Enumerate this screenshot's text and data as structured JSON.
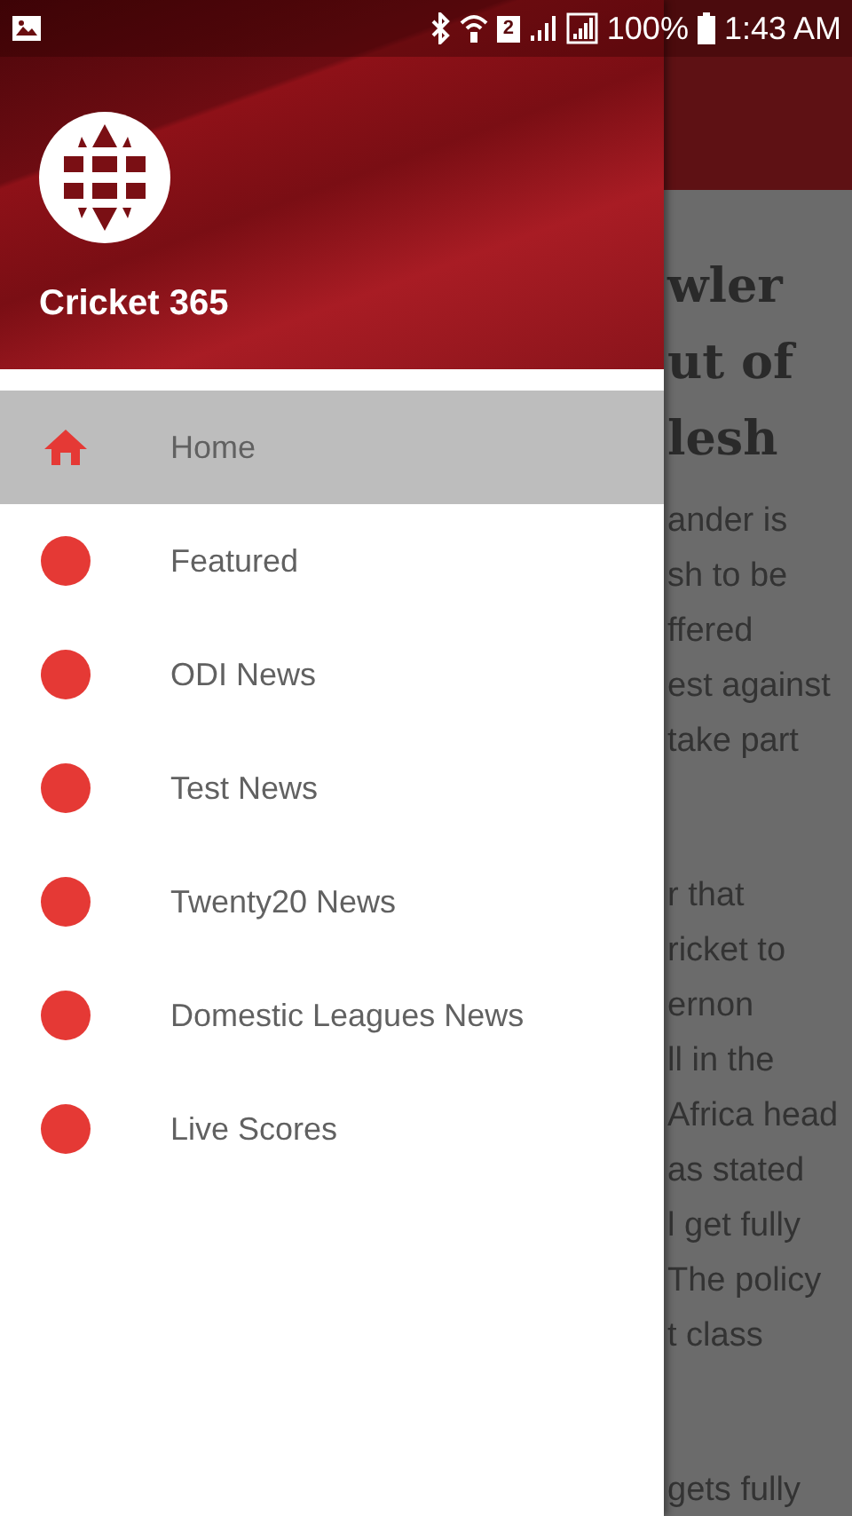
{
  "status_bar": {
    "sim": "2",
    "battery": "100%",
    "time": "1:43 AM"
  },
  "drawer": {
    "title": "Cricket 365",
    "items": [
      {
        "kind": "home",
        "label": "Home",
        "selected": true
      },
      {
        "kind": "dot",
        "label": "Featured",
        "selected": false
      },
      {
        "kind": "dot",
        "label": "ODI News",
        "selected": false
      },
      {
        "kind": "dot",
        "label": "Test News",
        "selected": false
      },
      {
        "kind": "dot",
        "label": "Twenty20 News",
        "selected": false
      },
      {
        "kind": "dot",
        "label": "Domestic Leagues News",
        "selected": false
      },
      {
        "kind": "dot",
        "label": "Live Scores",
        "selected": false
      }
    ]
  },
  "article": {
    "title_lines": [
      "wler",
      "ut of",
      "lesh"
    ],
    "paragraphs": [
      [
        "ander is",
        "sh to be",
        "ffered",
        "est against",
        "take part"
      ],
      [
        "r that",
        "ricket to",
        "ernon",
        "ll in the",
        "Africa head",
        "as stated",
        "l get fully",
        "The policy",
        "t class"
      ],
      [
        "gets fully"
      ]
    ]
  }
}
